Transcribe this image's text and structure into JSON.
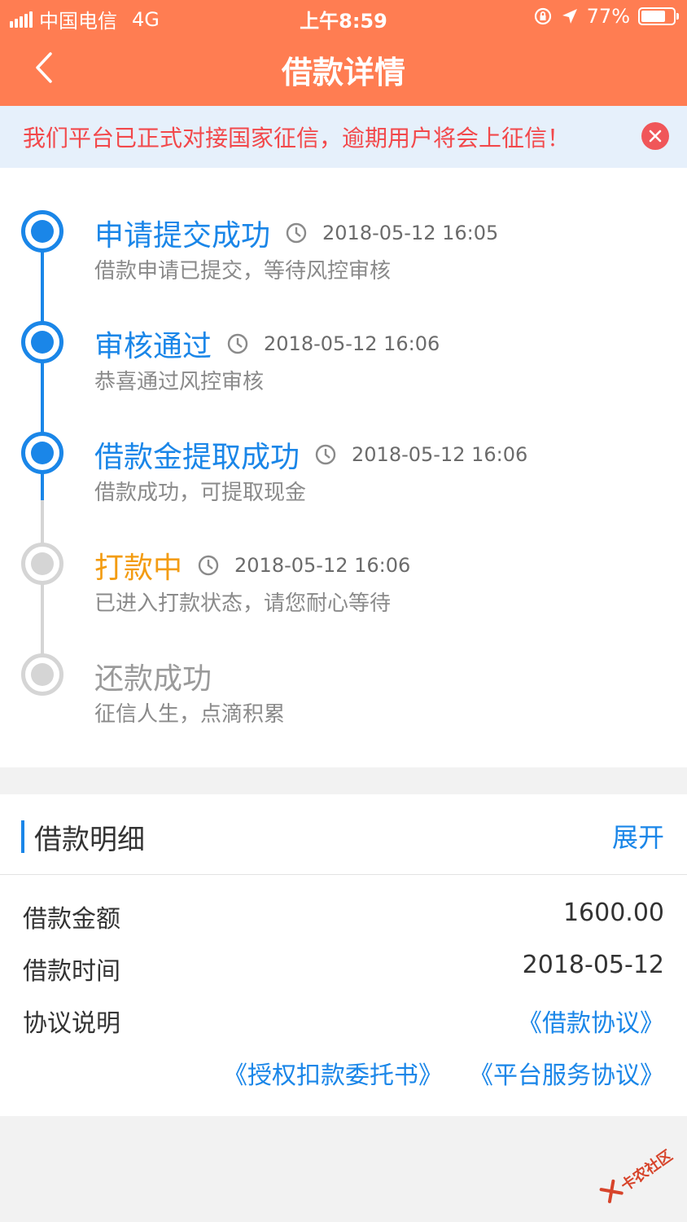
{
  "status_bar": {
    "carrier": "中国电信",
    "network": "4G",
    "time": "上午8:59",
    "battery": "77%",
    "battery_level": 0.77
  },
  "nav": {
    "title": "借款详情"
  },
  "notice": {
    "text": "我们平台已正式对接国家征信，逾期用户将会上征信！"
  },
  "timeline": {
    "steps": [
      {
        "title": "申请提交成功",
        "time": "2018-05-12 16:05",
        "desc": "借款申请已提交，等待风控审核",
        "state": "done"
      },
      {
        "title": "审核通过",
        "time": "2018-05-12 16:06",
        "desc": "恭喜通过风控审核",
        "state": "done"
      },
      {
        "title": "借款金提取成功",
        "time": "2018-05-12 16:06",
        "desc": "借款成功，可提取现金",
        "state": "done"
      },
      {
        "title": "打款中",
        "time": "2018-05-12 16:06",
        "desc": "已进入打款状态，请您耐心等待",
        "state": "current"
      },
      {
        "title": "还款成功",
        "time": "",
        "desc": "征信人生，点滴积累",
        "state": "pending"
      }
    ]
  },
  "detail": {
    "title": "借款明细",
    "expand": "展开",
    "rows": [
      {
        "label": "借款金额",
        "value": "1600.00"
      },
      {
        "label": "借款时间",
        "value": "2018-05-12"
      },
      {
        "label": "协议说明",
        "value": ""
      }
    ],
    "agreements": [
      "《借款协议》",
      "《授权扣款委托书》",
      "《平台服务协议》"
    ]
  },
  "watermark": {
    "text": "卡农社区"
  },
  "colors": {
    "header": "#ff7d52",
    "done": "#1a86e8",
    "current": "#f39c12",
    "pending": "#9a9a9a",
    "notice_text": "#f2484b"
  }
}
